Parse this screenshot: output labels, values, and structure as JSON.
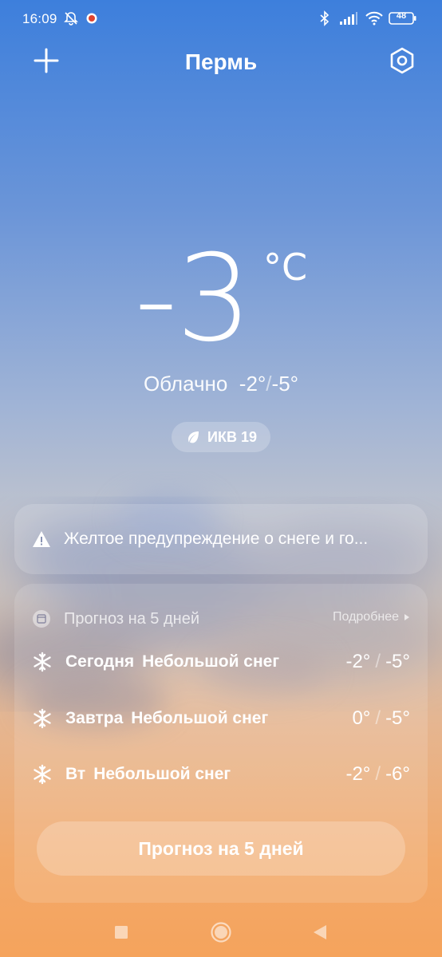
{
  "status_bar": {
    "time": "16:09",
    "battery": "48",
    "icons": [
      "bell-off-icon",
      "record-icon",
      "bluetooth-icon",
      "signal-icon",
      "wifi-icon",
      "battery-icon"
    ]
  },
  "header": {
    "city": "Пермь"
  },
  "current": {
    "temperature": "-3",
    "unit": "°C",
    "condition": "Облачно",
    "high": "-2°",
    "low": "-5°",
    "separator": "/",
    "aqi": "ИКВ 19"
  },
  "warning": {
    "text": "Желтое предупреждение о снеге и го..."
  },
  "forecast": {
    "title": "Прогноз на 5 дней",
    "more": "Подробнее",
    "days": [
      {
        "day": "Сегодня",
        "condition": "Небольшой снег",
        "high": "-2°",
        "low": "-5°"
      },
      {
        "day": "Завтра",
        "condition": "Небольшой снег",
        "high": "0°",
        "low": "-5°"
      },
      {
        "day": "Вт",
        "condition": "Небольшой снег",
        "high": "-2°",
        "low": "-6°"
      }
    ],
    "separator": "/",
    "button": "Прогноз на 5 дней"
  },
  "colors": {
    "sky_top": "#3d7fdc",
    "sky_bottom": "#f5a35c",
    "text": "#ffffff"
  }
}
